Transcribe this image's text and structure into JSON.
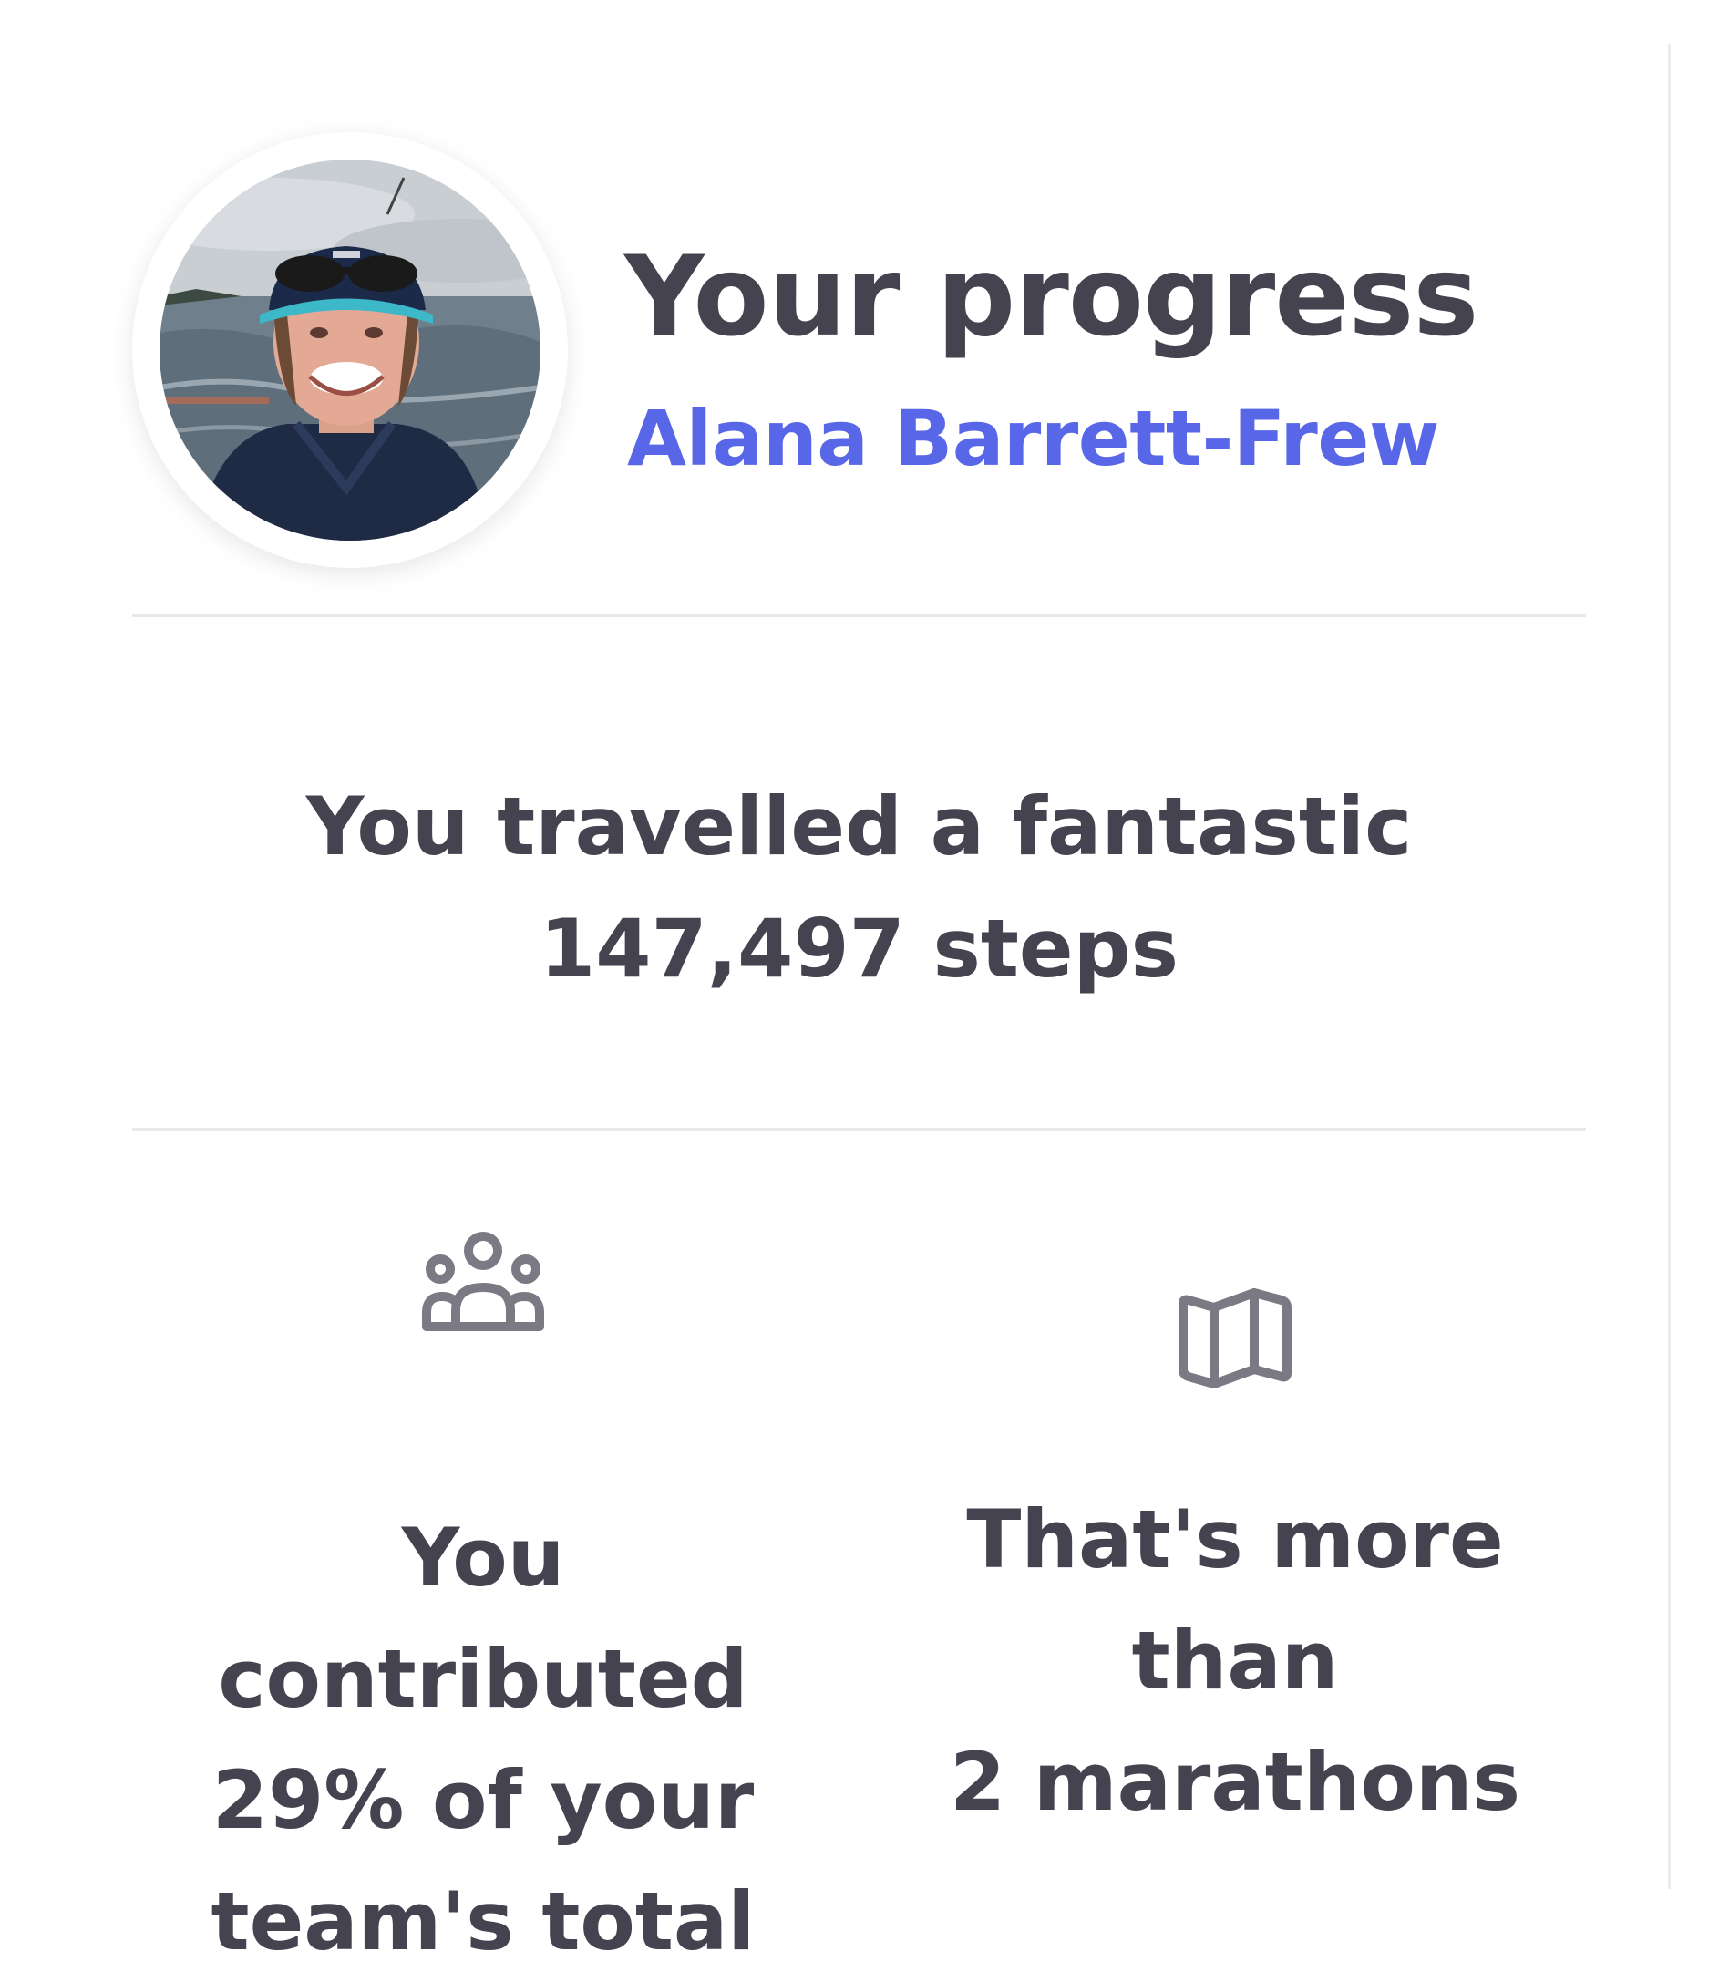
{
  "profile": {
    "title": "Your progress",
    "name": "Alana Barrett-Frew",
    "avatar_alt": "Profile photo"
  },
  "steps": {
    "line1": "You travelled a fantastic",
    "line2": "147,497 steps"
  },
  "stats": [
    {
      "icon": "team-icon",
      "lines": [
        "You contributed",
        "29% of your",
        "team's total"
      ]
    },
    {
      "icon": "map-icon",
      "lines": [
        "That's more than",
        "2 marathons"
      ]
    }
  ],
  "colors": {
    "text": "#45434f",
    "accent": "#5866e8",
    "divider": "#e9e9ed",
    "icon": "#7b7983"
  }
}
